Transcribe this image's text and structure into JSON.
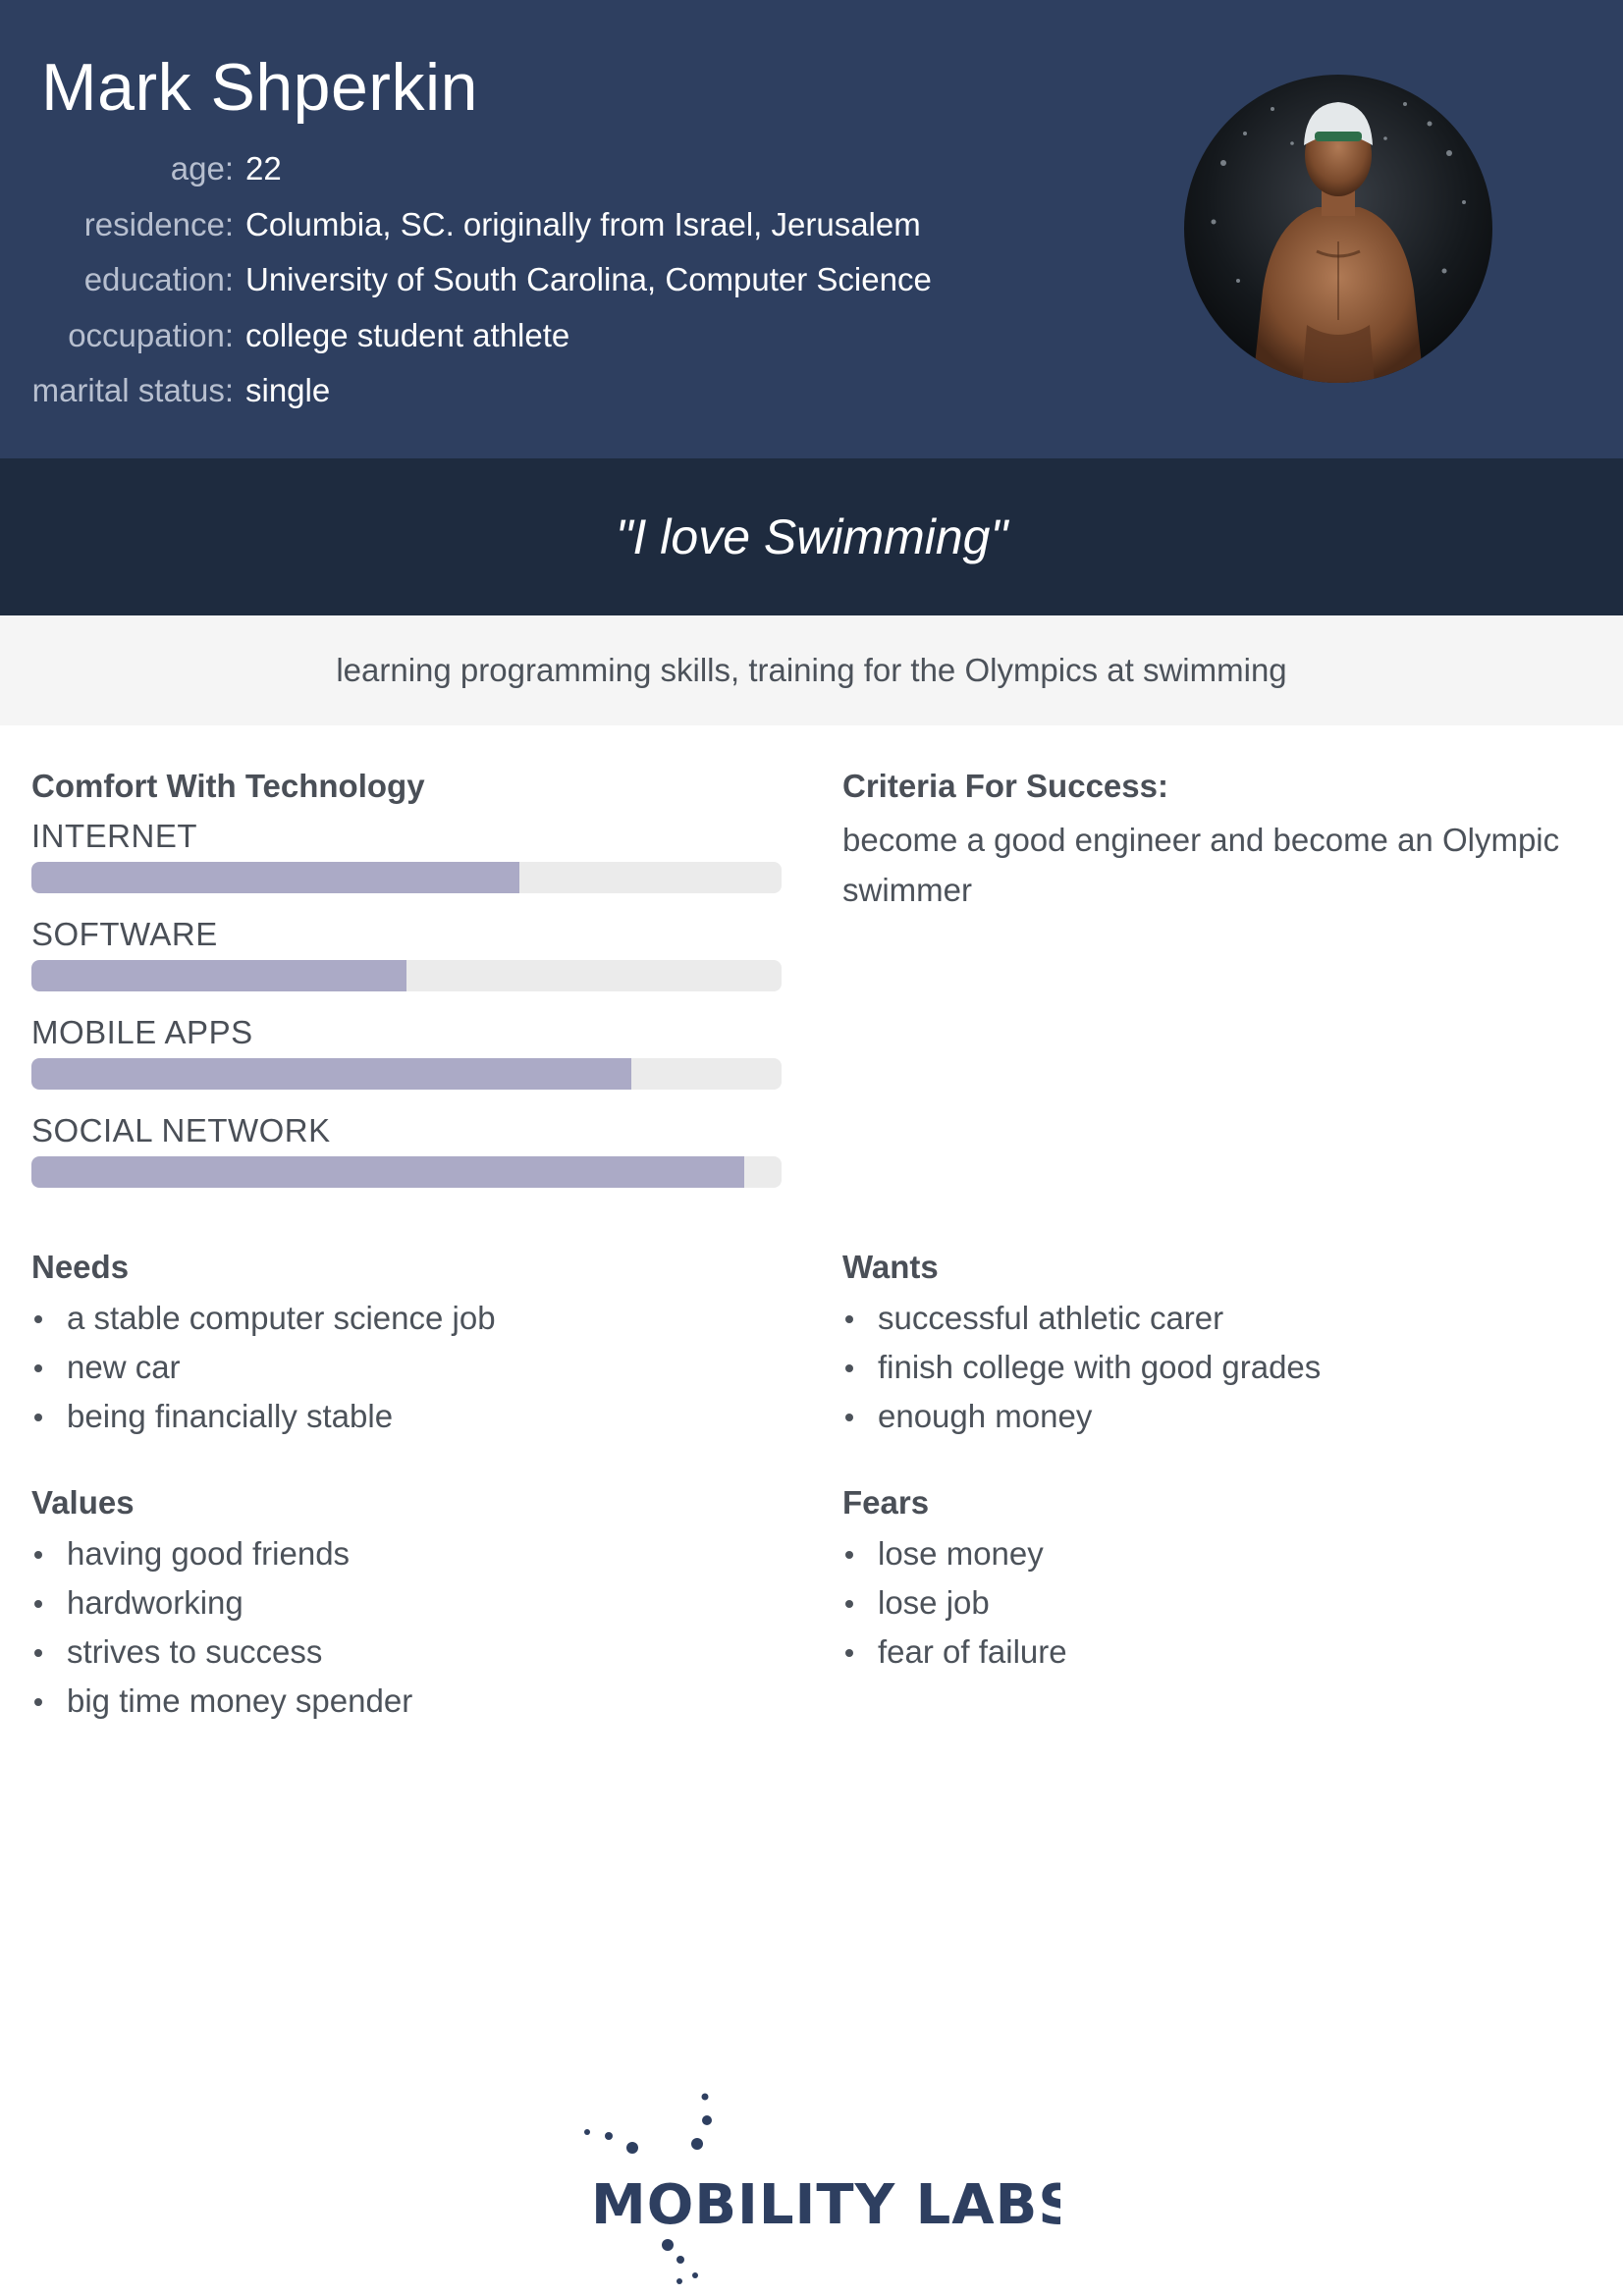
{
  "persona": {
    "name": "Mark Shperkin",
    "facts": [
      {
        "label": "age:",
        "value": "22"
      },
      {
        "label": "residence:",
        "value": "Columbia, SC. originally from Israel, Jerusalem"
      },
      {
        "label": "education:",
        "value": "University of South Carolina, Computer Science"
      },
      {
        "label": "occupation:",
        "value": "college student athlete"
      },
      {
        "label": "marital status:",
        "value": "single"
      }
    ],
    "photo": {
      "icon": "swimmer-portrait-photo"
    }
  },
  "quote": "\"I love Swimming\"",
  "goal": "learning programming skills, training for the Olympics at swimming",
  "comfort": {
    "title": "Comfort With Technology",
    "items": [
      {
        "label": "INTERNET",
        "level": 0.65
      },
      {
        "label": "SOFTWARE",
        "level": 0.5
      },
      {
        "label": "MOBILE APPS",
        "level": 0.8
      },
      {
        "label": "SOCIAL NETWORK",
        "level": 0.95
      }
    ]
  },
  "criteria": {
    "title": "Criteria For Success:",
    "text": "become a good engineer and become an Olympic swimmer"
  },
  "needs": {
    "title": "Needs",
    "items": [
      "a stable computer science job",
      "new car",
      "being financially stable"
    ]
  },
  "wants": {
    "title": "Wants",
    "items": [
      "successful athletic carer",
      "finish college with good grades",
      "enough money"
    ]
  },
  "values": {
    "title": "Values",
    "items": [
      "having good friends",
      "hardworking",
      "strives to success",
      "big time money spender"
    ]
  },
  "fears": {
    "title": "Fears",
    "items": [
      "lose money",
      "lose job",
      "fear of failure"
    ]
  },
  "logo": {
    "text": "MOBILITY LABS"
  },
  "colors": {
    "header": "#2e3f60",
    "quote_band": "#1e2b3f",
    "goal_band": "#f5f5f5",
    "bar_fill": "#abaac6",
    "bar_track": "#ebebeb"
  }
}
